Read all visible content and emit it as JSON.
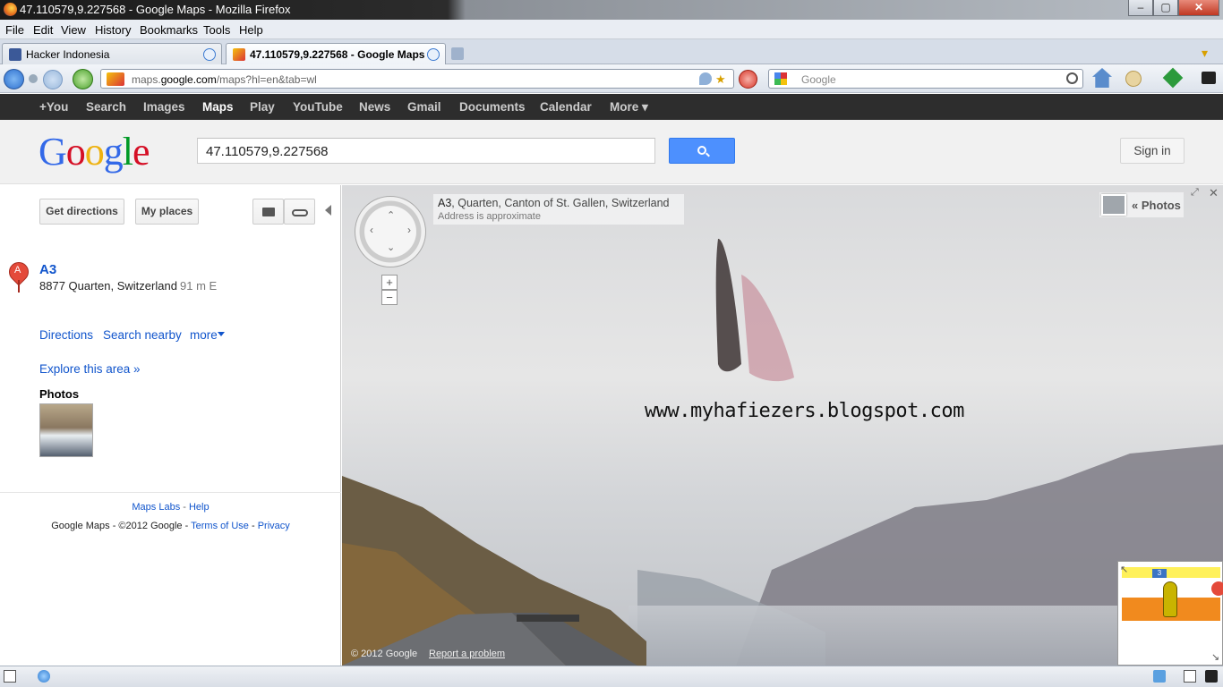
{
  "window": {
    "title": "47.110579,9.227568 - Google Maps - Mozilla Firefox",
    "minimize": "–",
    "maximize": "▢",
    "close": "✕"
  },
  "menu": [
    {
      "label": "File"
    },
    {
      "label": "Edit"
    },
    {
      "label": "View"
    },
    {
      "label": "History"
    },
    {
      "label": "Bookmarks"
    },
    {
      "label": "Tools"
    },
    {
      "label": "Help"
    }
  ],
  "tabs": [
    {
      "label": "Hacker Indonesia",
      "favicon": "facebook-icon"
    },
    {
      "label": "47.110579,9.227568 - Google Maps",
      "favicon": "google-maps-icon"
    }
  ],
  "urlbar": {
    "domain_prefix": "maps.",
    "domain": "google.com",
    "path": "/maps?hl=en&tab=wl"
  },
  "search": {
    "placeholder": "Google"
  },
  "gbar": [
    "+You",
    "Search",
    "Images",
    "Maps",
    "Play",
    "YouTube",
    "News",
    "Gmail",
    "Documents",
    "Calendar",
    "More ▾"
  ],
  "gbar_active": "Maps",
  "query": "47.110579,9.227568",
  "signin": "Sign in",
  "panel": {
    "get_directions": "Get directions",
    "my_places": "My places",
    "marker_letter": "A",
    "result_title": "A3",
    "result_address": "8877 Quarten, Switzerland",
    "result_distance": "91 m E",
    "actions": {
      "directions": "Directions",
      "search_nearby": "Search nearby",
      "more": "more"
    },
    "explore": "Explore this area »",
    "photos_heading": "Photos",
    "footer": {
      "maps_labs": "Maps Labs",
      "sep1": " - ",
      "help": "Help",
      "copyright": "Google Maps - ©2012 Google - ",
      "terms": "Terms of Use",
      "sep2": " - ",
      "privacy": "Privacy"
    }
  },
  "streetview": {
    "location_road": "A3",
    "location_rest": ", Quarten, Canton of St. Gallen, Switzerland",
    "approx": "Address is approximate",
    "photos_link": "« Photos",
    "watermark": "www.myhafiezers.blogspot.com",
    "copyright": "© 2012 Google",
    "report": "Report a problem",
    "zoom_in": "+",
    "zoom_out": "−",
    "minimap_route": "3"
  }
}
